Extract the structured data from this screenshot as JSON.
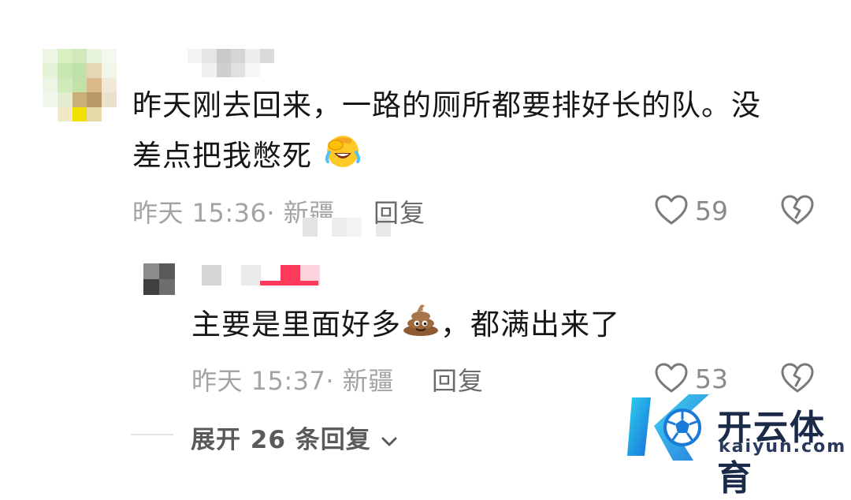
{
  "colors": {
    "text": "#161616",
    "meta": "#a3a3a3",
    "reply": "#6a6a6a",
    "accent": "#ff3b5c",
    "watermark_blue": "#1aa6e8"
  },
  "comment": {
    "text_line1": "昨天刚去回来，一路的厕所都要排好长的队。没",
    "text_line2": "差点把我憋死",
    "emoji": "face-palm-crying-emoji",
    "time": "昨天 15:36",
    "dot": "·",
    "location": "新疆",
    "reply_label": "回复",
    "likes": "59"
  },
  "reply": {
    "text_before": "主要是里面好多",
    "emoji": "poop-emoji",
    "text_after": "，都满出来了",
    "time": "昨天 15:37",
    "dot": "·",
    "location": "新疆",
    "reply_label": "回复",
    "likes": "53"
  },
  "expand": {
    "label": "展开 26 条回复"
  },
  "watermark": {
    "cn": "开云体育",
    "en": "kaiyun.com"
  }
}
